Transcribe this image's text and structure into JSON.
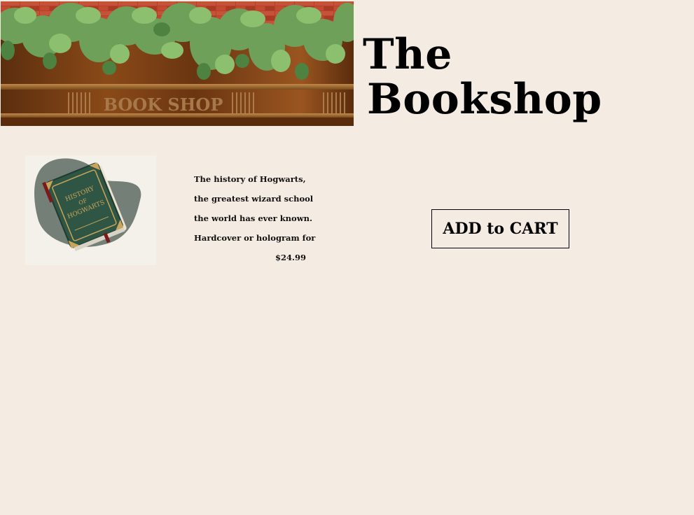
{
  "header": {
    "banner_sign_text": "BOOK SHOP",
    "title_line1": "The",
    "title_line2": "Bookshop"
  },
  "product": {
    "image_icon": "history-of-hogwarts-book",
    "cover_text": [
      "HISTORY",
      "OF",
      "HOGWARTS"
    ],
    "description_lines": [
      "The history of Hogwarts,",
      "the greatest wizard school",
      "the world has ever known.",
      "Hardcover or hologram for"
    ],
    "price": "$24.99",
    "add_to_cart_label": "ADD to CART"
  },
  "colors": {
    "page_background": "#f4ebe2",
    "text": "#000000",
    "book_cover": "#2f5544",
    "book_trim": "#c9a55a",
    "banner_wood": "#7a3f14"
  }
}
